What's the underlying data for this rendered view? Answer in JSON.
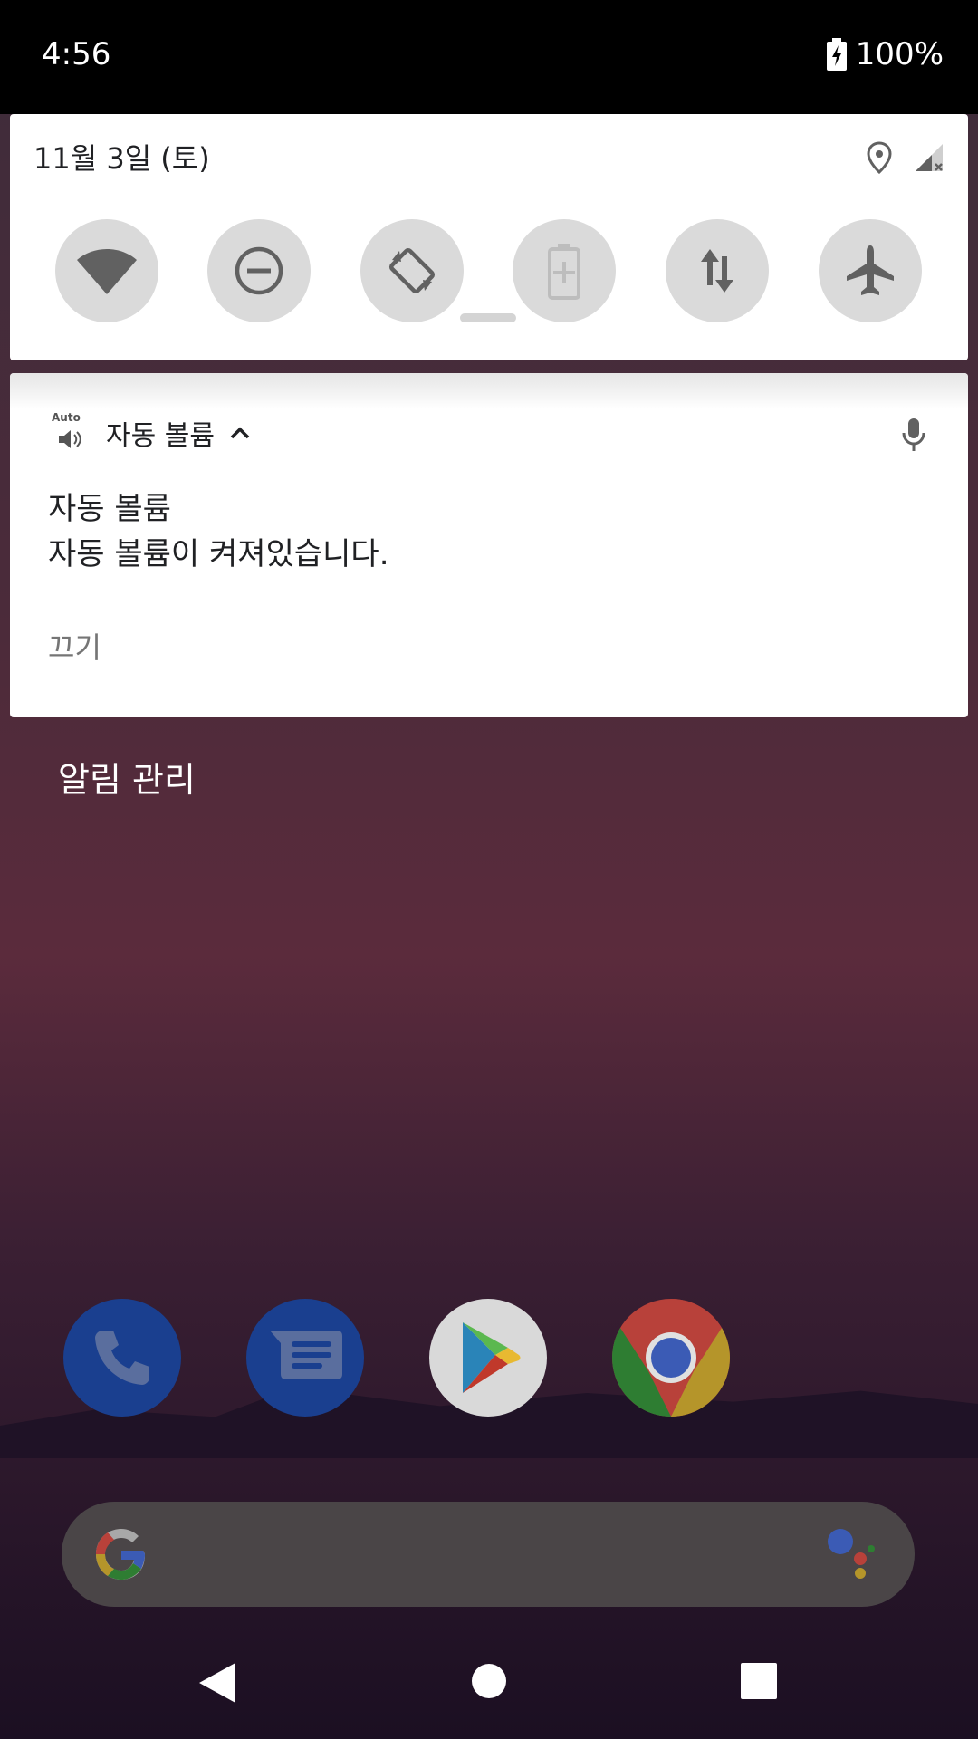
{
  "status_bar": {
    "time": "4:56",
    "battery": "100%"
  },
  "quick_settings": {
    "date": "11월 3일 (토)",
    "tiles": [
      {
        "icon": "wifi-icon"
      },
      {
        "icon": "do-not-disturb-icon"
      },
      {
        "icon": "auto-rotate-icon"
      },
      {
        "icon": "battery-saver-icon"
      },
      {
        "icon": "mobile-data-icon"
      },
      {
        "icon": "airplane-mode-icon"
      }
    ]
  },
  "notification": {
    "app_name": "자동 볼륨",
    "app_icon_label": "Auto",
    "title": "자동 볼륨",
    "text": "자동 볼륨이 켜져있습니다.",
    "action": "끄기"
  },
  "manage_notifications": "알림 관리",
  "dock": [
    {
      "icon": "phone-icon",
      "color": "#1a3f8f"
    },
    {
      "icon": "messages-icon",
      "color": "#1a3f8f"
    },
    {
      "icon": "play-store-icon",
      "color": "#d9d9d9"
    },
    {
      "icon": "chrome-icon",
      "color": "#c0392b"
    }
  ],
  "colors": {
    "tile_bg": "#dadada",
    "icon_gray": "#616161"
  }
}
